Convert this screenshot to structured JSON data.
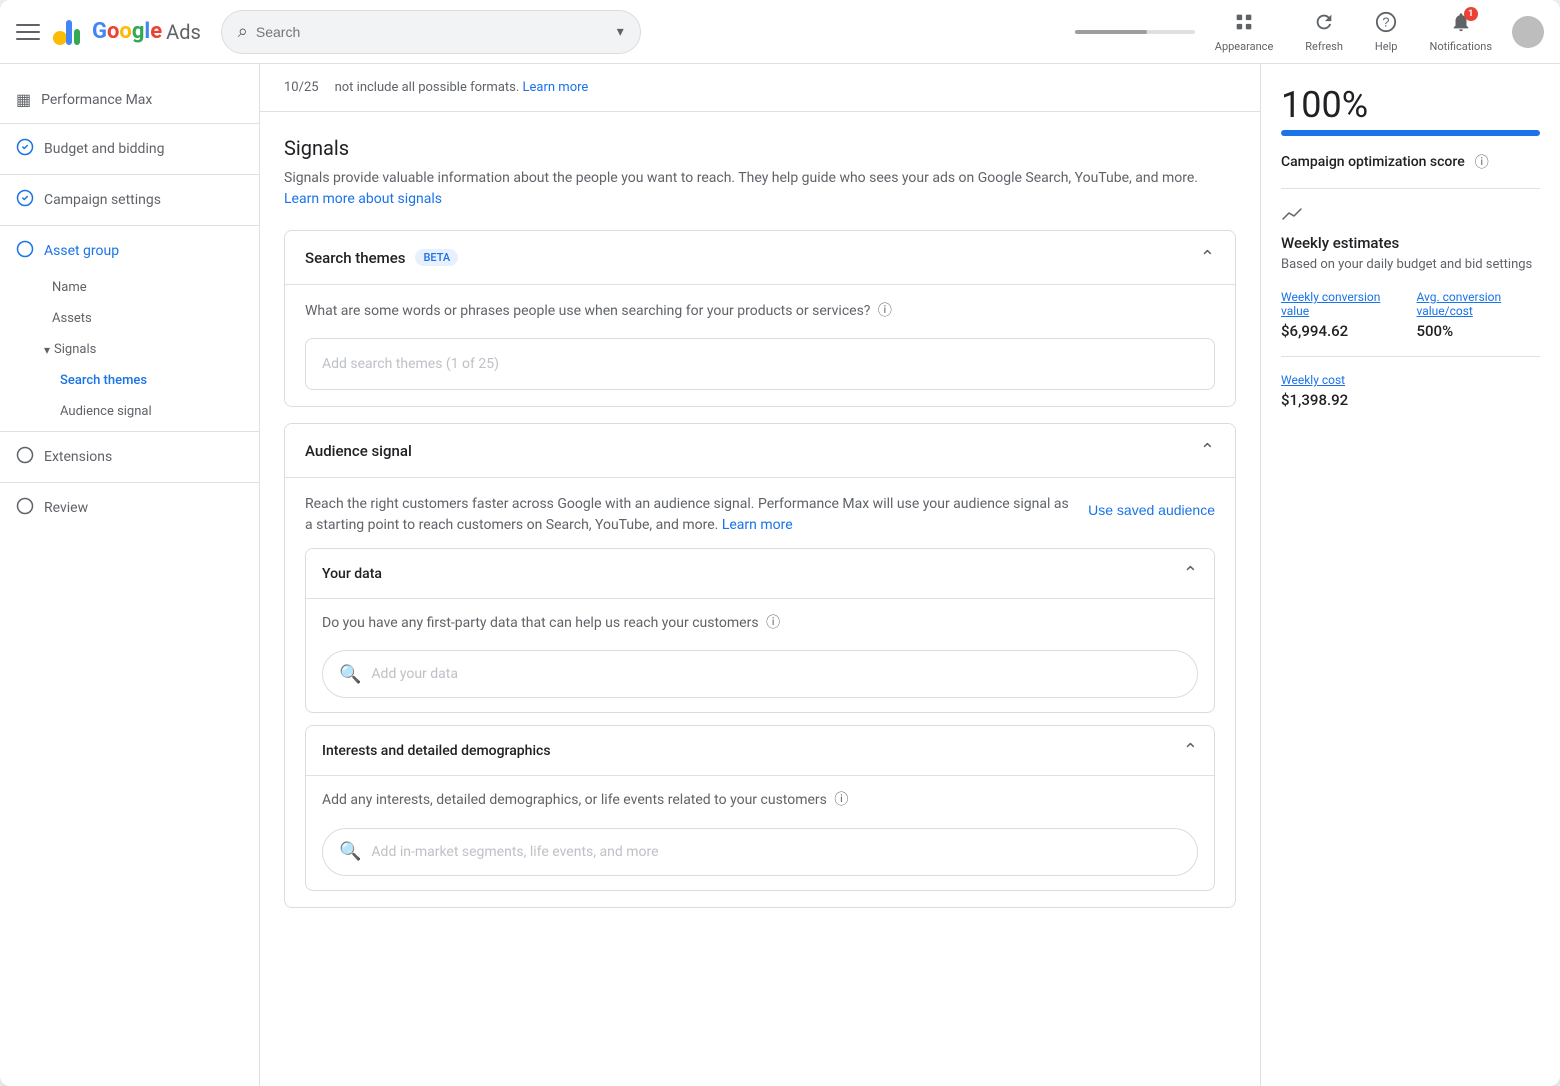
{
  "app": {
    "title": "Google Ads",
    "logo_text": "Google",
    "ads_text": "Ads"
  },
  "nav": {
    "search_placeholder": "Search",
    "search_value": "",
    "appearance_label": "Appearance",
    "refresh_label": "Refresh",
    "help_label": "Help",
    "notifications_label": "Notifications",
    "notification_count": "1"
  },
  "sidebar": {
    "items": [
      {
        "label": "Performance Max",
        "icon": "▦",
        "state": "default",
        "id": "perf-max"
      },
      {
        "label": "Budget and bidding",
        "icon": "✓",
        "state": "completed",
        "id": "budget"
      },
      {
        "label": "Campaign settings",
        "icon": "✓",
        "state": "completed",
        "id": "campaign-settings"
      },
      {
        "label": "Asset group",
        "icon": "○",
        "state": "active",
        "id": "asset-group"
      }
    ],
    "sub_items": [
      {
        "label": "Name",
        "id": "name"
      },
      {
        "label": "Assets",
        "id": "assets"
      },
      {
        "label": "Signals",
        "id": "signals",
        "expandable": true
      },
      {
        "label": "Search themes",
        "id": "search-themes",
        "active": true
      },
      {
        "label": "Audience signal",
        "id": "audience-signal"
      }
    ],
    "bottom_items": [
      {
        "label": "Extensions",
        "icon": "○",
        "id": "extensions"
      },
      {
        "label": "Review",
        "icon": "○",
        "id": "review"
      }
    ]
  },
  "top_snippet": {
    "count": "10/25",
    "description_text": "not include all possible formats.",
    "learn_more": "Learn more"
  },
  "signals": {
    "title": "Signals",
    "description": "Signals provide valuable information about the people you want to reach. They help guide who sees your ads on Google Search, YouTube, and more.",
    "learn_more_text": "Learn more about signals",
    "learn_more_href": "#"
  },
  "search_themes_card": {
    "title": "Search themes",
    "beta_label": "BETA",
    "question": "What are some words or phrases people use when searching for your products or services?",
    "input_placeholder": "Add search themes (1 of 25)"
  },
  "audience_signal_card": {
    "title": "Audience signal",
    "description": "Reach the right customers faster across Google with an audience signal. Performance Max will use your audience signal as a starting point to reach customers on Search, YouTube, and more.",
    "learn_more_text": "Learn more",
    "use_saved_label": "Use saved audience"
  },
  "your_data_card": {
    "title": "Your data",
    "question": "Do you have any first-party data that can help us reach your customers",
    "input_placeholder": "Add your data"
  },
  "interests_card": {
    "title": "Interests and detailed demographics",
    "question": "Add any interests, detailed demographics, or life events related to your customers",
    "input_placeholder": "Add in-market segments, life events, and more"
  },
  "right_panel": {
    "score_value": "100%",
    "score_label": "Campaign optimization score",
    "weekly_title": "Weekly estimates",
    "weekly_subtitle": "Based on your daily budget and bid settings",
    "weekly_conversion_label": "Weekly conversion value",
    "weekly_conversion_value": "$6,994.62",
    "avg_conversion_label": "Avg. conversion value/cost",
    "avg_conversion_value": "500%",
    "weekly_cost_label": "Weekly cost",
    "weekly_cost_value": "$1,398.92"
  }
}
